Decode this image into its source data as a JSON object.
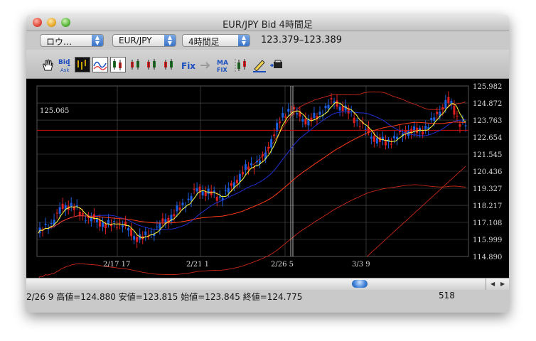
{
  "window": {
    "title": "EUR/JPY Bid 4時間足"
  },
  "toolbar": {
    "chart_type": "ロウ…",
    "symbol": "EUR/JPY",
    "timeframe": "4時間足",
    "price_range": "123.379–123.389",
    "tools": [
      {
        "name": "hand-tool-icon"
      },
      {
        "name": "bid-ask-toggle-icon",
        "label_top": "Bid",
        "label_bottom": "Ask"
      },
      {
        "name": "bar-chart-icon"
      },
      {
        "name": "line-chart-icon"
      },
      {
        "name": "candlestick-chart-icon"
      },
      {
        "name": "candle-style-2-icon"
      },
      {
        "name": "candle-style-3-icon"
      },
      {
        "name": "candle-style-4-icon"
      },
      {
        "name": "fix-icon",
        "label": "Fix"
      },
      {
        "name": "arrow-icon"
      },
      {
        "name": "ma-fix-icon",
        "label_top": "MA",
        "label_bottom": "FIX"
      },
      {
        "name": "indicator-icon"
      },
      {
        "name": "pencil-draw-icon"
      },
      {
        "name": "print-icon"
      }
    ]
  },
  "chart_data": {
    "type": "candlestick",
    "y_ticks": [
      "125.982",
      "124.872",
      "123.763",
      "122.654",
      "121.545",
      "120.436",
      "119.327",
      "118.217",
      "117.108",
      "115.999",
      "114.890"
    ],
    "ylim": [
      114.89,
      125.982
    ],
    "x_ticks": [
      "2/17 17",
      "2/21 1",
      "2/26 5",
      "3/3 9"
    ],
    "high_label": "125.065",
    "current_line": 123.1,
    "colors": {
      "up": "#1b5fe0",
      "down": "#e02020",
      "ma1": "#ffff40",
      "ma2": "#1f2fd0",
      "ma3": "#ff3a1a",
      "current": "#d01010",
      "grid": "#555555",
      "text": "#d8d8d8"
    }
  },
  "scrollbar": {
    "value": 0.735
  },
  "status": {
    "ohlc": "2/26 9 高値=124.880 安値=123.815 始値=123.845 終値=124.775",
    "count": "518"
  }
}
